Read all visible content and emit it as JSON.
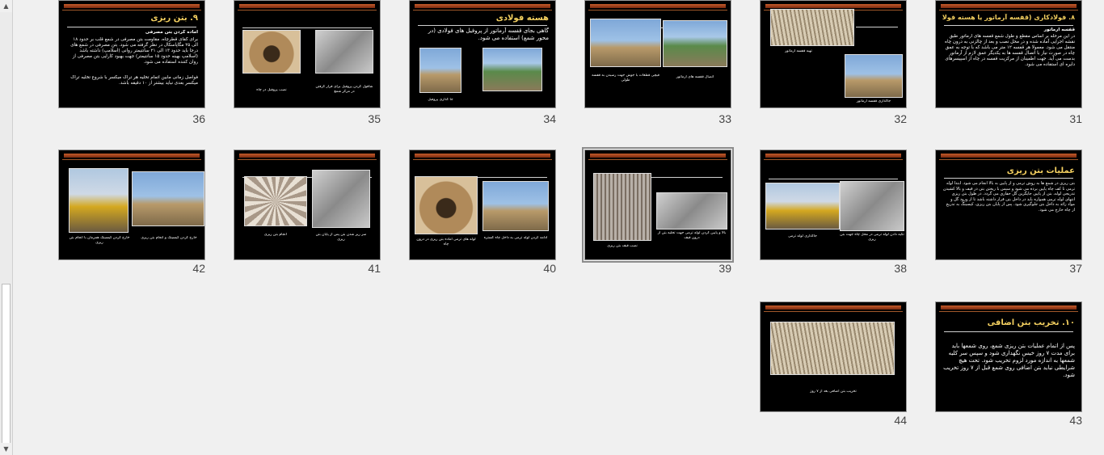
{
  "slides": [
    {
      "num": "36",
      "title": "۹. بتن ریزی",
      "lines": [
        "آماده کردن بتن مصرفی",
        "برای کفای قطرچاه، مقاومت بتن مصرفی در شمع قلب بر حدود ۱۸ الی ۲۵ مگاپاسکال در نظر گرفته می شود. بتن مصرفی در شمع های درجا باید حدود ۱۳ الی ۲۱ سانتیمتر روانی (اسلامپ) داشته باشد (اسلامپ بهینه حدود ۱۵ سانتیمتر) جهت بهبود کارایی بتن مصرفی از روان کننده استفاده می شود.",
        "فواصل زمانی مابین اتمام تخلیه هر تراک میکسر با شروع تخلیه تراک میکسر بعدی نباید بیشتر از ۱۰ دقیقه باشد."
      ],
      "captions": []
    },
    {
      "num": "35",
      "title": "",
      "lines": [],
      "captions": [
        "نصب پروفیل در چاه",
        "شاقول کردن پروفیل برای قرار گرفتن در مرکز شمع"
      ]
    },
    {
      "num": "34",
      "title": "هسته فولادی",
      "lines": [
        "گاهی بجای قفسه آرماتور از پروفیل های فولادی (در محور شمع) استفاده می شود."
      ],
      "captions": [
        "جا گذاری پروفیل"
      ]
    },
    {
      "num": "33",
      "title": "",
      "lines": [],
      "captions": [
        "اتصال قفسه های آرماتور",
        "قیچی قطعات با جوش جهت رسیدن به قفسه طولی"
      ]
    },
    {
      "num": "32",
      "title": "",
      "lines": [],
      "captions": [
        "تهیه قفسه آرماتور",
        "جاگذاری قفسه آرماتور"
      ]
    },
    {
      "num": "31",
      "title": "۸. فولادکاری (قفسه آرماتور یا هسته فولادی)",
      "lines": [
        "قفسه آرماتور",
        "در این مرحله بر اساس مقطع و طول شمع قفسه های آرماتور طبق نقشه اجرایی آماده شده و در محل نصب و بعد از چالزنی به درون چاه منتقل می شود. معمولا هر قفسه ۱۲ متر می باشد که با توجه به عمق چاه در صورت نیاز با اتصال قفسه ها به یکدیگر عمق لازم از آرماتور بدست می آید. جهت اطمینان از مرکزیت قفسه در چاه از اسپیسرهای دایره ای استفاده می شود."
      ],
      "captions": []
    },
    {
      "num": "42",
      "title": "",
      "lines": [],
      "captions": [
        "خارج کردن کیسینگ همزمان با انجام بتن ریزی",
        "خارج کردن کیسینگ و انجام بتن ریزی"
      ]
    },
    {
      "num": "41",
      "title": "",
      "lines": [],
      "captions": [
        "انجام بتن ریزی",
        "سر ریز شدن بتن پس از پایان بتن ریزی"
      ]
    },
    {
      "num": "40",
      "title": "",
      "lines": [],
      "captions": [
        "لوله های ترمی آماده بتن ریزی در درون چاه",
        "ادامه کردن لوله ترمی به داخل چاه گستره"
      ]
    },
    {
      "num": "39",
      "title": "",
      "lines": [],
      "captions": [
        "نصب قیف بتن ریزی",
        "بالا و پایین کردن لوله ترمی جهت تخلیه بتن از درون قیف"
      ]
    },
    {
      "num": "38",
      "title": "",
      "lines": [],
      "captions": [
        "جاگذاری لوله ترمی",
        "تکیه دادن لوله ترمی در محل چاه جهت بتن ریزی"
      ]
    },
    {
      "num": "37",
      "title": "عملیات بتن ریزی",
      "lines": [
        "بتن ریزی در شمع ها به روش ترمی و از پایین به بالا انجام می شود. ابتدا لوله ترمی تا کف چاه پایین برده می شود و سپس با ریختن بتن در قیف و بالا کشیدن تدریجی لوله، بتن از پایین جایگزین گل حفاری می گردد. در طول بتن ریزی انتهای لوله ترمی همواره باید در داخل بتن قرار داشته باشد تا از ورود گل و مواد زائد به داخل بتن جلوگیری شود. پس از پایان بتن ریزی، کیسینگ به تدریج از چاه خارج می شود."
      ],
      "captions": []
    },
    {
      "num": "44",
      "title": "",
      "lines": [],
      "captions": [
        "تخریب بتن اضافی بعد از ۷ روز"
      ]
    },
    {
      "num": "43",
      "title": "۱۰. تخریب بتن اضافی",
      "lines": [
        "پس از اتمام عملیات بتن ریزی شمع، روی شمعها باید برای مدت ۷ روز خیس نگهداری شود و سپس سر کلیه شمعها به اندازه مورد لزوم تخریب شود. تحت هیچ شرایطی نباید بتن اضافی روی شمع قبل از ۷ روز تخریب شود."
      ],
      "captions": []
    }
  ]
}
